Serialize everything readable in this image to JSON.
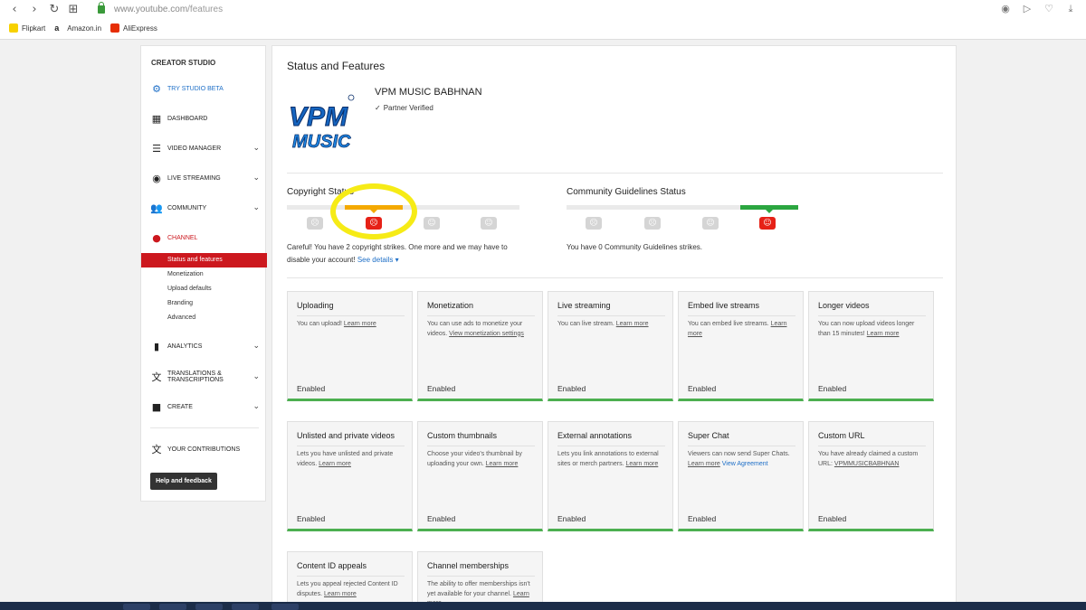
{
  "browser": {
    "url_host": "www.youtube.com",
    "url_path": "/features",
    "bookmarks": [
      {
        "label": "Flipkart",
        "color": "#f7d100"
      },
      {
        "label": "Amazon.in",
        "color": "#222222"
      },
      {
        "label": "AliExpress",
        "color": "#e62e04"
      }
    ]
  },
  "sidebar": {
    "title": "CREATOR STUDIO",
    "try_beta": "TRY STUDIO BETA",
    "dashboard": "DASHBOARD",
    "video_manager": "VIDEO MANAGER",
    "live_streaming": "LIVE STREAMING",
    "community": "COMMUNITY",
    "channel": "CHANNEL",
    "channel_sub": [
      "Status and features",
      "Monetization",
      "Upload defaults",
      "Branding",
      "Advanced"
    ],
    "analytics": "ANALYTICS",
    "translations_1": "TRANSLATIONS &",
    "translations_2": "TRANSCRIPTIONS",
    "create": "CREATE",
    "contributions": "YOUR CONTRIBUTIONS",
    "help": "Help and feedback"
  },
  "main": {
    "title": "Status and Features",
    "logo_text_1": "VPM",
    "logo_text_2": "MUSIC",
    "channel_name": "VPM MUSIC BABHNAN",
    "verified": "Partner Verified",
    "copyright": {
      "title": "Copyright Status",
      "strikes": 2,
      "desc_1": "Careful! You have 2 copyright strikes. One more and we may have to",
      "desc_2": "disable your account!",
      "link": "See details",
      "accent": "#f4a900"
    },
    "community": {
      "title": "Community Guidelines Status",
      "strikes": 0,
      "desc": "You have 0 Community Guidelines strikes.",
      "accent": "#2ba640"
    },
    "cards": [
      {
        "title": "Uploading",
        "desc": "You can upload!",
        "link": "Learn more",
        "status": "Enabled"
      },
      {
        "title": "Monetization",
        "desc": "You can use ads to monetize your videos.",
        "link": "View monetization settings",
        "status": "Enabled"
      },
      {
        "title": "Live streaming",
        "desc": "You can live stream.",
        "link": "Learn more",
        "status": "Enabled"
      },
      {
        "title": "Embed live streams",
        "desc": "You can embed live streams.",
        "link": "Learn more",
        "status": "Enabled"
      },
      {
        "title": "Longer videos",
        "desc": "You can now upload videos longer than 15 minutes!",
        "link": "Learn more",
        "status": "Enabled"
      },
      {
        "title": "Unlisted and private videos",
        "desc": "Lets you have unlisted and private videos.",
        "link": "Learn more",
        "status": "Enabled"
      },
      {
        "title": "Custom thumbnails",
        "desc": "Choose your video's thumbnail by uploading your own.",
        "link": "Learn more",
        "status": "Enabled"
      },
      {
        "title": "External annotations",
        "desc": "Lets you link annotations to external sites or merch partners.",
        "link": "Learn more",
        "status": "Enabled"
      },
      {
        "title": "Super Chat",
        "desc": "Viewers can now send Super Chats.",
        "link": "Learn more",
        "extra": "View Agreement",
        "status": "Enabled"
      },
      {
        "title": "Custom URL",
        "desc": "You have already claimed a custom URL:",
        "link": "VPMMUSICBABHNAN",
        "status": "Enabled"
      },
      {
        "title": "Content ID appeals",
        "desc": "Lets you appeal rejected Content ID disputes.",
        "link": "Learn more",
        "status": ""
      },
      {
        "title": "Channel memberships",
        "desc": "The ability to offer memberships isn't yet available for your channel.",
        "link": "Learn more",
        "status": ""
      }
    ]
  }
}
